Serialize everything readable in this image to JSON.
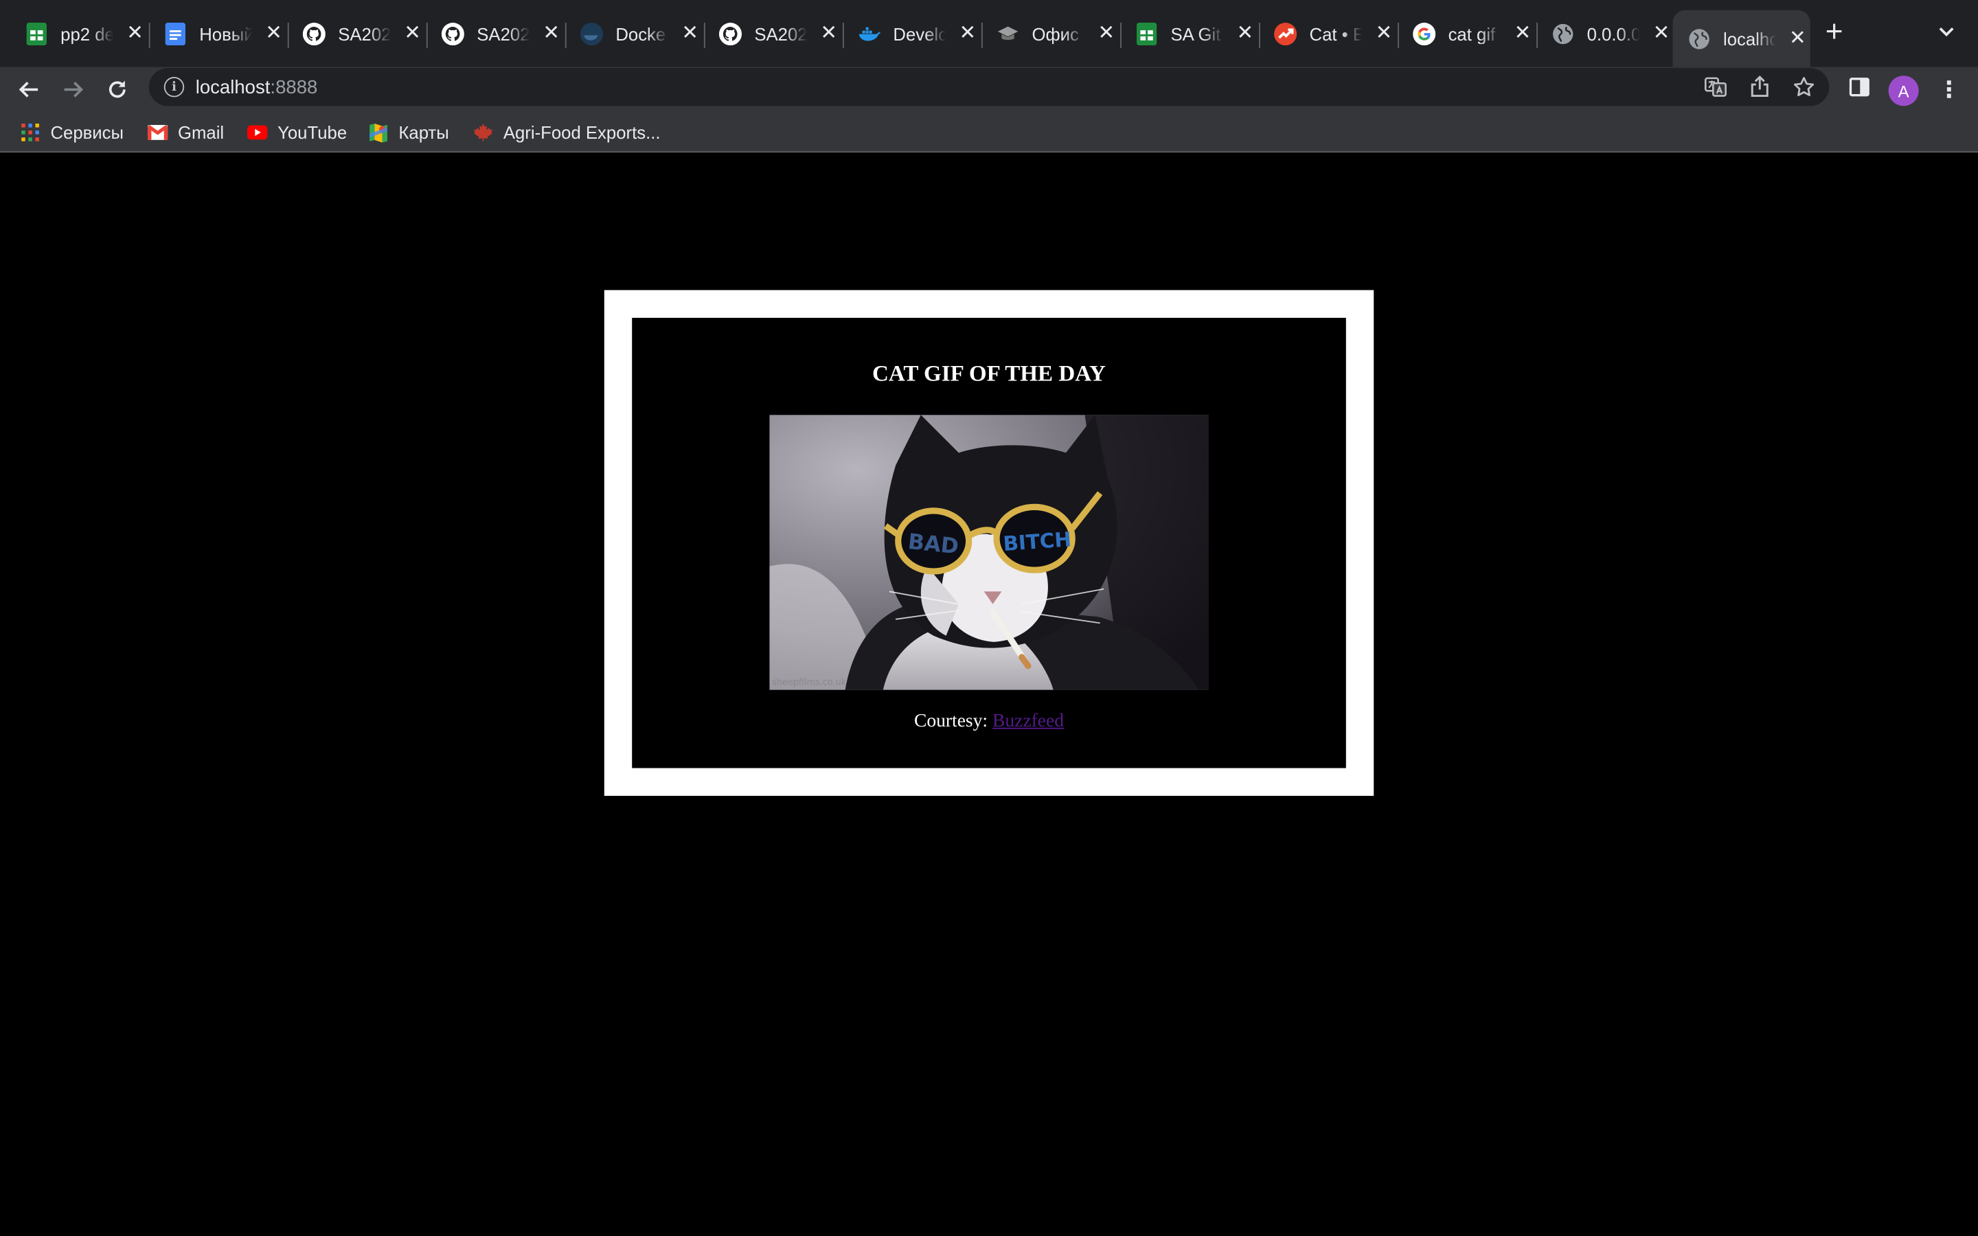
{
  "tabs": [
    {
      "title": "pp2 de",
      "icon": "google-sheets-icon",
      "color": "#1e8e3e"
    },
    {
      "title": "Новый",
      "icon": "google-docs-icon",
      "color": "#4285f4"
    },
    {
      "title": "SA202",
      "icon": "github-icon",
      "color": "#ffffff"
    },
    {
      "title": "SA202",
      "icon": "github-icon",
      "color": "#ffffff"
    },
    {
      "title": "Docke",
      "icon": "docker-dark-icon",
      "color": "#1d3b57"
    },
    {
      "title": "SA202",
      "icon": "github-icon",
      "color": "#ffffff"
    },
    {
      "title": "Develo",
      "icon": "docker-icon",
      "color": "#2496ed"
    },
    {
      "title": "Офис",
      "icon": "graduation-cap-icon",
      "color": "#9e9e9e"
    },
    {
      "title": "SA Git",
      "icon": "google-sheets-icon",
      "color": "#1e8e3e"
    },
    {
      "title": "Cat • E",
      "icon": "trending-icon",
      "color": "#e8432d"
    },
    {
      "title": "cat gif",
      "icon": "google-icon",
      "color": "#ffffff"
    },
    {
      "title": "0.0.0.0",
      "icon": "globe-icon",
      "color": "#9aa0a6"
    },
    {
      "title": "localhost",
      "icon": "globe-icon",
      "color": "#9aa0a6",
      "active": true
    }
  ],
  "omnibox": {
    "host": "localhost",
    "port": ":8888"
  },
  "avatar": "A",
  "bookmarks": [
    {
      "label": "Сервисы",
      "icon": "apps-grid-icon"
    },
    {
      "label": "Gmail",
      "icon": "gmail-icon"
    },
    {
      "label": "YouTube",
      "icon": "youtube-icon"
    },
    {
      "label": "Карты",
      "icon": "maps-icon"
    },
    {
      "label": "Agri-Food Exports...",
      "icon": "maple-leaf-icon"
    }
  ],
  "page": {
    "heading": "CAT GIF OF THE DAY",
    "courtesy_label": "Courtesy:",
    "courtesy_link": "Buzzfeed",
    "image_watermark": "sheepfilms.co.uk"
  },
  "colors": {
    "tabstrip": "#202124",
    "toolbar": "#35363a",
    "page_bg": "#000000",
    "frame": "#ffffff",
    "link_visited": "#551a8b",
    "avatar": "#9c4dcc"
  }
}
